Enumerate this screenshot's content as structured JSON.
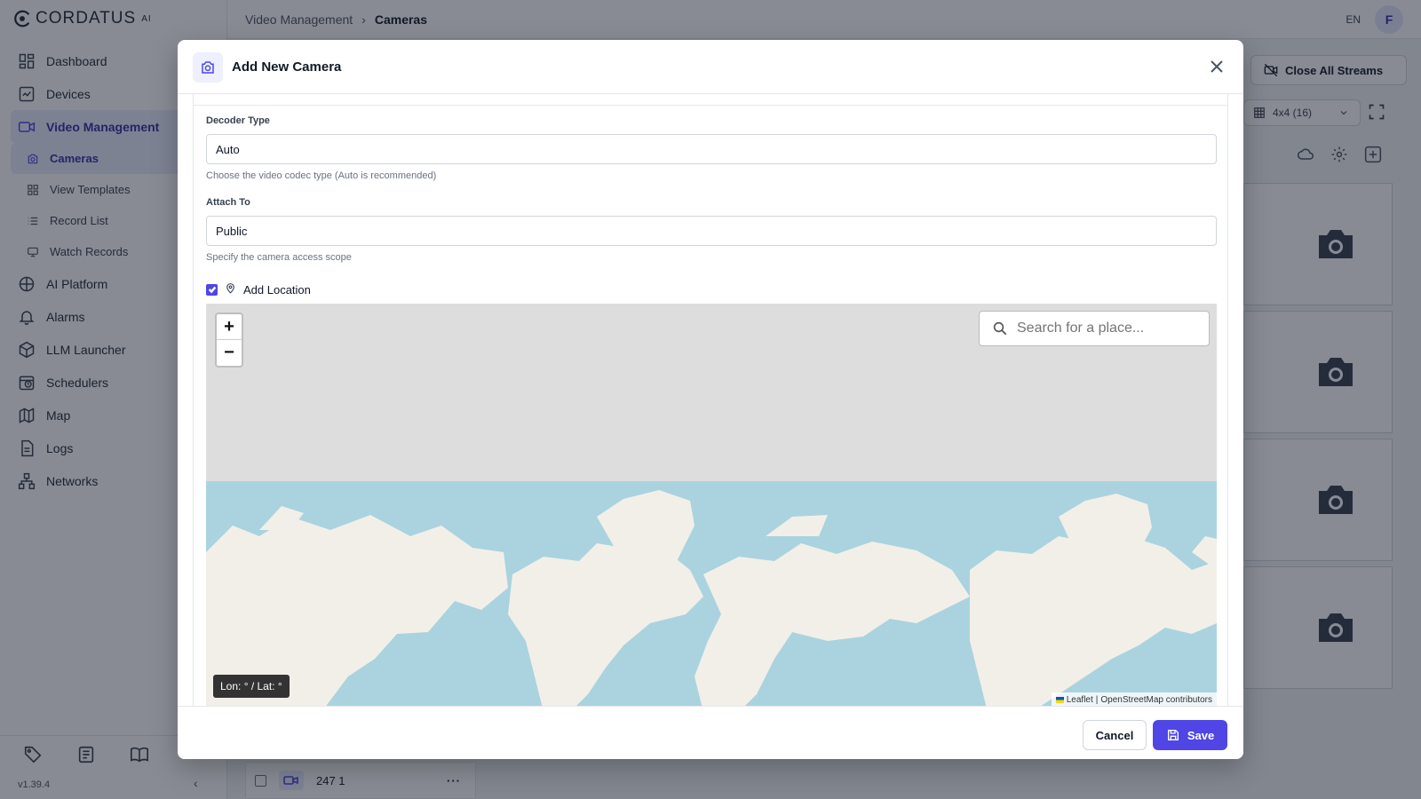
{
  "app": {
    "logo_text": "CORDATUS",
    "logo_sup": "AI",
    "version": "v1.39.4"
  },
  "sidebar": {
    "items": [
      {
        "label": "Dashboard",
        "icon": "dashboard-icon"
      },
      {
        "label": "Devices",
        "icon": "devices-icon"
      },
      {
        "label": "Video Management",
        "icon": "video-icon",
        "active": true
      },
      {
        "label": "AI Platform",
        "icon": "ai-icon"
      },
      {
        "label": "Alarms",
        "icon": "bell-icon"
      },
      {
        "label": "LLM Launcher",
        "icon": "cube-icon"
      },
      {
        "label": "Schedulers",
        "icon": "clock-icon"
      },
      {
        "label": "Map",
        "icon": "map-icon"
      },
      {
        "label": "Logs",
        "icon": "file-icon"
      },
      {
        "label": "Networks",
        "icon": "network-icon"
      }
    ],
    "sub_items": [
      {
        "label": "Cameras",
        "icon": "camera-icon",
        "active": true
      },
      {
        "label": "View Templates",
        "icon": "grid-icon"
      },
      {
        "label": "Record List",
        "icon": "list-icon"
      },
      {
        "label": "Watch Records",
        "icon": "monitor-icon"
      }
    ],
    "footer_icons": [
      "tag-icon",
      "news-icon",
      "book-icon"
    ]
  },
  "topbar": {
    "breadcrumb_parent": "Video Management",
    "breadcrumb_sep": "›",
    "breadcrumb_current": "Cameras",
    "lang": "EN",
    "avatar": "F"
  },
  "camera_panel": {
    "close_streams": "Close All Streams",
    "grid_select": "4x4 (16)",
    "row_label": "247 1"
  },
  "modal": {
    "title": "Add New Camera",
    "decoder_label": "Decoder Type",
    "decoder_value": "Auto",
    "decoder_hint": "Choose the video codec type (Auto is recommended)",
    "attach_label": "Attach To",
    "attach_value": "Public",
    "attach_hint": "Specify the camera access scope",
    "add_location_label": "Add Location",
    "add_location_checked": true,
    "map": {
      "zoom_in": "+",
      "zoom_out": "−",
      "search_placeholder": "Search for a place...",
      "coords": "Lon: ° / Lat: °",
      "attrib_leaflet": "Leaflet",
      "attrib_sep": "|",
      "attrib_osm": "OpenStreetMap contributors",
      "ocean_color": "#aad3df",
      "land_color": "#f2efe9",
      "empty_color": "#dddddd"
    },
    "cancel": "Cancel",
    "save": "Save"
  },
  "colors": {
    "accent": "#4f46e5",
    "overlay": "rgba(17,24,39,0.5)"
  }
}
